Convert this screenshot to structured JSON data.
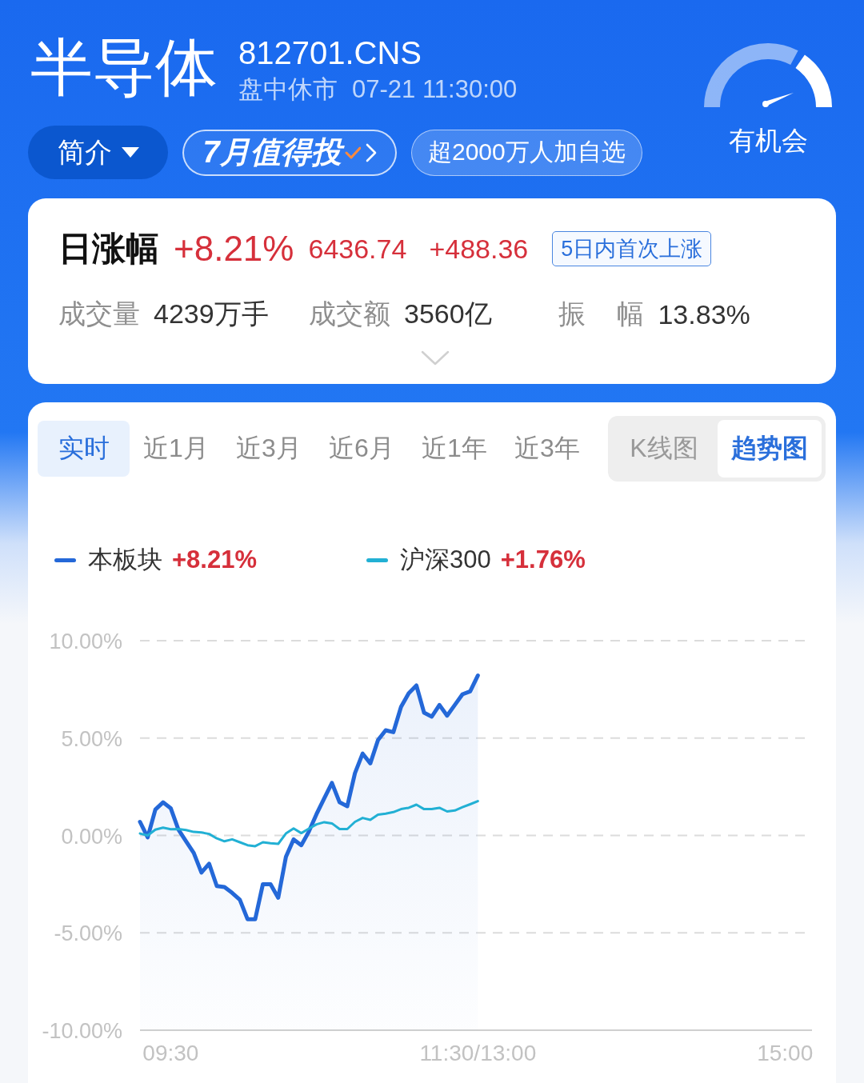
{
  "header": {
    "title": "半导体",
    "code": "812701.CNS",
    "status": "盘中休市",
    "time": "07-21 11:30:00",
    "rating": "有机会"
  },
  "header_buttons": [
    {
      "kind": "menu",
      "label": "简介"
    },
    {
      "kind": "promo",
      "label": "7月值得投"
    },
    {
      "kind": "info",
      "label": "超2000万人加自选"
    }
  ],
  "quote": {
    "label": "日涨幅",
    "change_pct": "+8.21%",
    "price": "6436.74",
    "change": "+488.36",
    "tag": "5日内首次上涨",
    "stats": [
      {
        "label": "成交量",
        "value": "4239万手"
      },
      {
        "label": "成交额",
        "value": "3560亿"
      },
      {
        "label": "振 幅",
        "value": "13.83%"
      }
    ]
  },
  "chart_panel": {
    "tabs": [
      {
        "label": "实时",
        "selected": true
      },
      {
        "label": "近1月",
        "selected": false
      },
      {
        "label": "近3月",
        "selected": false
      },
      {
        "label": "近6月",
        "selected": false
      },
      {
        "label": "近1年",
        "selected": false
      },
      {
        "label": "近3年",
        "selected": false
      }
    ],
    "modes": [
      {
        "label": "K线图",
        "selected": false
      },
      {
        "label": "趋势图",
        "selected": true
      }
    ],
    "legend_changes": [
      "+8.21%",
      "+1.76%"
    ],
    "chart_data": {
      "type": "line",
      "grid": true,
      "categories": [
        null,
        null,
        null,
        null,
        "09:30",
        null,
        null,
        null,
        null,
        null,
        null,
        null,
        null,
        null,
        null,
        null,
        null,
        null,
        null,
        null,
        null,
        null,
        null,
        null,
        null,
        null,
        null,
        null,
        null,
        null,
        null,
        null,
        null,
        null,
        null,
        null,
        null,
        null,
        null,
        null,
        null,
        null,
        null,
        null,
        "11:30/13:00",
        null,
        null,
        null,
        null,
        null,
        null,
        null,
        null,
        null,
        null,
        null,
        null,
        null,
        null,
        null,
        null,
        null,
        null,
        null,
        null,
        null,
        null,
        null,
        null,
        null,
        null,
        null,
        null,
        null,
        null,
        null,
        null,
        null,
        null,
        null,
        null,
        null,
        null,
        null,
        "15:00",
        null,
        null,
        null
      ],
      "ylim": [
        -10,
        10
      ],
      "yticks": [
        {
          "value": 10,
          "label": "10.00%"
        },
        {
          "value": 5,
          "label": "5.00%"
        },
        {
          "value": 0,
          "label": "0.00%"
        },
        {
          "value": -5,
          "label": "-5.00%"
        },
        {
          "value": -10,
          "label": "-10.00%"
        }
      ],
      "series": [
        {
          "name": "本板块",
          "color": "#2468d8",
          "values": [
            0.7,
            -0.1,
            1.33,
            1.7,
            1.4,
            0.3,
            -0.3,
            -0.9,
            -1.9,
            -1.45,
            -2.6,
            -2.65,
            -2.95,
            -3.3,
            -4.3,
            -4.3,
            -2.5,
            -2.5,
            -3.2,
            -1.1,
            -0.2,
            -0.5,
            0.2,
            1.1,
            1.9,
            2.7,
            1.7,
            1.5,
            3.2,
            4.2,
            3.7,
            4.9,
            5.4,
            5.3,
            6.6,
            7.3,
            7.7,
            6.3,
            6.1,
            6.7,
            6.15,
            6.7,
            7.25,
            7.4,
            8.21,
            null,
            null,
            null,
            null,
            null,
            null,
            null,
            null,
            null,
            null,
            null,
            null,
            null,
            null,
            null,
            null,
            null,
            null,
            null,
            null,
            null,
            null,
            null,
            null,
            null,
            null,
            null,
            null,
            null,
            null,
            null,
            null,
            null,
            null,
            null,
            null,
            null,
            null,
            null,
            null,
            null,
            null,
            null
          ]
        },
        {
          "name": "沪深300",
          "color": "#22b0d4",
          "values": [
            0.1,
            0.0,
            0.3,
            0.4,
            0.32,
            0.33,
            0.28,
            0.18,
            0.15,
            0.08,
            -0.15,
            -0.3,
            -0.2,
            -0.35,
            -0.5,
            -0.55,
            -0.35,
            -0.4,
            -0.43,
            0.1,
            0.36,
            0.12,
            0.35,
            0.57,
            0.68,
            0.62,
            0.33,
            0.33,
            0.7,
            0.9,
            0.8,
            1.07,
            1.12,
            1.2,
            1.35,
            1.42,
            1.58,
            1.35,
            1.35,
            1.42,
            1.23,
            1.28,
            1.45,
            1.6,
            1.76,
            null,
            null,
            null,
            null,
            null,
            null,
            null,
            null,
            null,
            null,
            null,
            null,
            null,
            null,
            null,
            null,
            null,
            null,
            null,
            null,
            null,
            null,
            null,
            null,
            null,
            null,
            null,
            null,
            null,
            null,
            null,
            null,
            null,
            null,
            null,
            null,
            null,
            null,
            null,
            null,
            null,
            null,
            null
          ]
        }
      ]
    }
  }
}
